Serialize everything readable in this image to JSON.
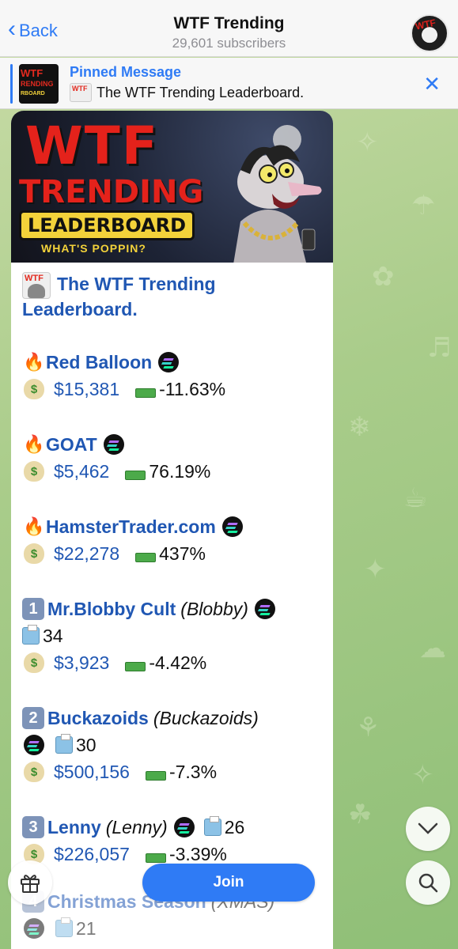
{
  "header": {
    "back_label": "Back",
    "title": "WTF Trending",
    "subtitle": "29,601 subscribers"
  },
  "pinned": {
    "label": "Pinned Message",
    "text": "The WTF Trending Leaderboard."
  },
  "banner": {
    "line1": "WTF",
    "line2": "TRENDING",
    "line3": "LEADERBOARD",
    "line4": "WHAT'S POPPIN?"
  },
  "message": {
    "heading_line1": "The WTF Trending",
    "heading_line2": "Leaderboard.",
    "entries": [
      {
        "name": "Red Balloon",
        "price": "$15,381",
        "change": "-11.63%"
      },
      {
        "name": "GOAT",
        "price": "$5,462",
        "change": "76.19%"
      },
      {
        "name": "HamsterTrader.com",
        "price": "$22,278",
        "change": "437%"
      },
      {
        "rank": "1",
        "name": "Mr.Blobby Cult",
        "ticker": "(Blobby)",
        "count": "34",
        "price": "$3,923",
        "change": "-4.42%"
      },
      {
        "rank": "2",
        "name": "Buckazoids",
        "ticker": "(Buckazoids)",
        "count": "30",
        "price": "$500,156",
        "change": "-7.3%"
      },
      {
        "rank": "3",
        "name": "Lenny",
        "ticker": "(Lenny)",
        "count": "26",
        "price": "$226,057",
        "change": "-3.39%"
      },
      {
        "rank": "4",
        "name": "Christmas Season",
        "ticker": "(XMAS)",
        "count": "21"
      }
    ]
  },
  "controls": {
    "join_label": "Join"
  },
  "colors": {
    "accent": "#2f7bf5",
    "link": "#2057b3",
    "brand_red": "#e4221b"
  }
}
